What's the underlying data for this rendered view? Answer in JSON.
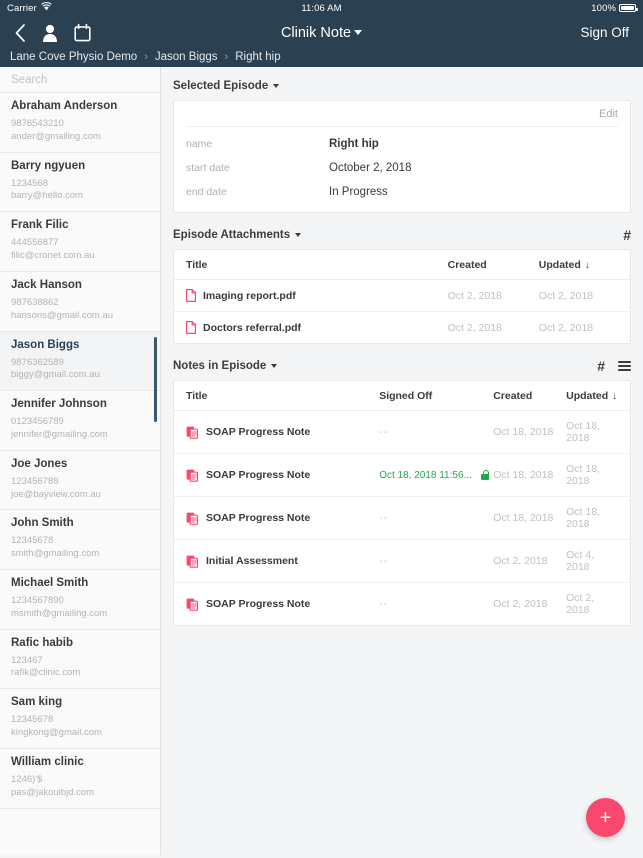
{
  "colors": {
    "header_bg": "#2b4152",
    "accent_pink": "#f9486f",
    "signed_green": "#21a84b"
  },
  "statusbar": {
    "carrier": "Carrier",
    "wifi_icon": "wifi-icon",
    "time": "11:06 AM",
    "battery_percent": "100%"
  },
  "navbar": {
    "back_icon": "back-chevron-icon",
    "person_icon": "person-icon",
    "calendar_icon": "calendar-icon",
    "title": "Clinik Note",
    "title_caret_icon": "chevron-down-icon",
    "signoff_label": "Sign Off"
  },
  "breadcrumb": {
    "items": [
      "Lane Cove Physio Demo",
      "Jason Biggs",
      "Right hip"
    ],
    "separator": "›"
  },
  "sidebar": {
    "search": {
      "placeholder": "Search",
      "value": ""
    },
    "patients": [
      {
        "name": "Abraham Anderson",
        "phone": "9876543210",
        "email": "ander@gmailing.com",
        "selected": false
      },
      {
        "name": "Barry ngyuen",
        "phone": "1234568",
        "email": "barry@hello.com",
        "selected": false
      },
      {
        "name": "Frank Filic",
        "phone": "444556877",
        "email": "filic@cronet.com.au",
        "selected": false
      },
      {
        "name": "Jack Hanson",
        "phone": "987638862",
        "email": "hansons@gmail.com.au",
        "selected": false
      },
      {
        "name": "Jason Biggs",
        "phone": "9876362589",
        "email": "biggy@gmail.com.au",
        "selected": true
      },
      {
        "name": "Jennifer Johnson",
        "phone": "0123456789",
        "email": "jennifer@gmailing.com",
        "selected": false
      },
      {
        "name": "Joe Jones",
        "phone": "123456789",
        "email": "joe@bayview.com.au",
        "selected": false
      },
      {
        "name": "John Smith",
        "phone": "12345678",
        "email": "smith@gmailing.com",
        "selected": false
      },
      {
        "name": "Michael Smith",
        "phone": "1234567890",
        "email": "msmith@gmailing.com",
        "selected": false
      },
      {
        "name": "Rafic habib",
        "phone": "123467",
        "email": "rafik@clinic.com",
        "selected": false
      },
      {
        "name": "Sam king",
        "phone": "12345678",
        "email": "kingkong@gmail.com",
        "selected": false
      },
      {
        "name": "William  clinic",
        "phone": "1246)'$",
        "email": "pas@jakouibjd.com",
        "selected": false
      }
    ]
  },
  "episode": {
    "section_title": "Selected Episode",
    "caret_icon": "chevron-down-icon",
    "edit_label": "Edit",
    "fields": [
      {
        "label": "name",
        "value": "Right hip",
        "bold": true
      },
      {
        "label": "start date",
        "value": "October 2, 2018",
        "bold": false
      },
      {
        "label": "end date",
        "value": "In Progress",
        "bold": false
      }
    ]
  },
  "attachments": {
    "section_title": "Episode Attachments",
    "caret_icon": "chevron-down-icon",
    "hash_icon": "hash-icon",
    "columns": [
      "Title",
      "Created",
      "Updated"
    ],
    "sort_arrow": "↓",
    "sort_column": "Updated",
    "rows": [
      {
        "icon": "pdf-file-icon",
        "title": "Imaging report.pdf",
        "created": "Oct 2, 2018",
        "updated": "Oct 2, 2018"
      },
      {
        "icon": "pdf-file-icon",
        "title": "Doctors referral.pdf",
        "created": "Oct 2, 2018",
        "updated": "Oct 2, 2018"
      }
    ]
  },
  "notes": {
    "section_title": "Notes in Episode",
    "caret_icon": "chevron-down-icon",
    "hash_icon": "hash-icon",
    "list_icon": "list-lines-icon",
    "columns": [
      "Title",
      "Signed Off",
      "Created",
      "Updated"
    ],
    "sort_arrow": "↓",
    "sort_column": "Updated",
    "rows": [
      {
        "icon": "note-document-icon",
        "title": "SOAP Progress Note",
        "signed_off": "--",
        "signed": false,
        "lock_icon": "",
        "created": "Oct 18, 2018",
        "updated": "Oct 18, 2018"
      },
      {
        "icon": "note-document-icon",
        "title": "SOAP Progress Note",
        "signed_off": "Oct 18, 2018 11:56...",
        "signed": true,
        "lock_icon": "lock-icon",
        "created": "Oct 18, 2018",
        "updated": "Oct 18, 2018"
      },
      {
        "icon": "note-document-icon",
        "title": "SOAP Progress Note",
        "signed_off": "--",
        "signed": false,
        "lock_icon": "",
        "created": "Oct 18, 2018",
        "updated": "Oct 18, 2018"
      },
      {
        "icon": "note-document-icon",
        "title": "Initial Assessment",
        "signed_off": "--",
        "signed": false,
        "lock_icon": "",
        "created": "Oct 2, 2018",
        "updated": "Oct 4, 2018"
      },
      {
        "icon": "note-document-icon",
        "title": "SOAP Progress Note",
        "signed_off": "--",
        "signed": false,
        "lock_icon": "",
        "created": "Oct 2, 2018",
        "updated": "Oct 2, 2018"
      }
    ]
  },
  "fab": {
    "label": "+",
    "icon": "plus-icon"
  }
}
